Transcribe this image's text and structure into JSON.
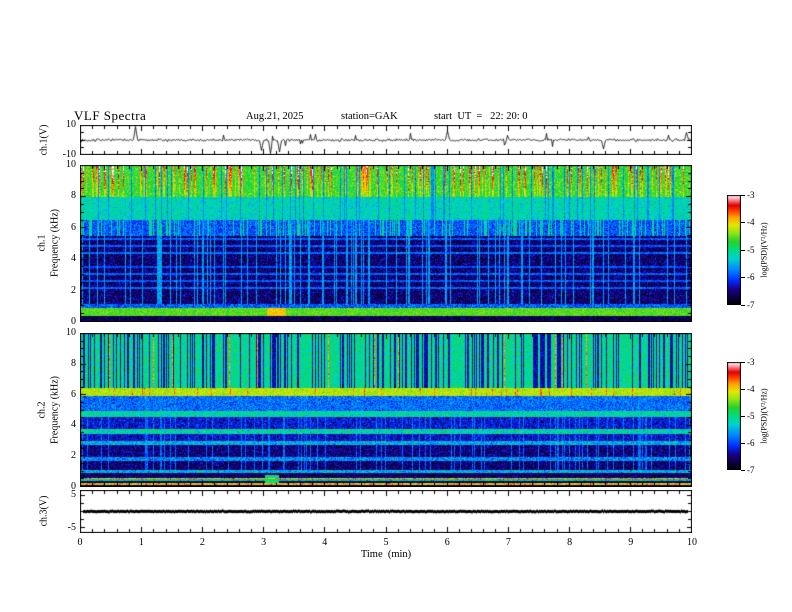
{
  "header": {
    "title": "VLF Spectra",
    "date": "Aug.21, 2025",
    "station": "station=GAK",
    "start_ut": "start  UT  =   22: 20: 0"
  },
  "x_axis": {
    "label": "Time  (min)",
    "ticks": [
      "0",
      "1",
      "2",
      "3",
      "4",
      "5",
      "6",
      "7",
      "8",
      "9",
      "10"
    ],
    "range_min": [
      0,
      10
    ]
  },
  "panels": {
    "ch1_wave": {
      "ylabel": "ch.1(V)",
      "ytick_top": "10",
      "ytick_bottom": "-10"
    },
    "ch1_spec": {
      "ylabel_ch": "ch.1",
      "ylabel_axis": "Frequency (kHz)"
    },
    "ch2_spec": {
      "ylabel_ch": "ch.2",
      "ylabel_axis": "Frequency (kHz)"
    },
    "ch3_wave": {
      "ylabel": "ch.3(V)",
      "ytick_top": "5",
      "ytick_bottom": "-5"
    }
  },
  "colorbars": [
    {
      "label": "log(PSD)(V²/Hz)",
      "ticks": [
        "-3",
        "-4",
        "-5",
        "-6",
        "-7"
      ],
      "value_top": -3,
      "value_bottom": -7
    },
    {
      "label": "log(PSD)(V²/Hz)",
      "ticks": [
        "-3",
        "-4",
        "-5",
        "-6",
        "-7"
      ],
      "value_top": -3,
      "value_bottom": -7
    }
  ],
  "colormap_stops": [
    [
      0.0,
      0,
      0,
      0
    ],
    [
      0.06,
      10,
      0,
      60
    ],
    [
      0.14,
      25,
      0,
      135
    ],
    [
      0.22,
      0,
      45,
      255
    ],
    [
      0.32,
      0,
      135,
      255
    ],
    [
      0.42,
      0,
      210,
      210
    ],
    [
      0.5,
      0,
      220,
      130
    ],
    [
      0.58,
      40,
      210,
      40
    ],
    [
      0.66,
      150,
      230,
      20
    ],
    [
      0.73,
      230,
      230,
      0
    ],
    [
      0.8,
      255,
      160,
      0
    ],
    [
      0.86,
      255,
      60,
      0
    ],
    [
      0.91,
      225,
      0,
      0
    ],
    [
      0.96,
      255,
      140,
      150
    ],
    [
      1.0,
      255,
      255,
      255
    ]
  ],
  "chart_data": [
    {
      "type": "line",
      "id": "ch1_waveform",
      "ylabel": "ch.1(V)",
      "ylim": [
        -10,
        10
      ],
      "yticks": [
        10,
        -10
      ],
      "x_range_min": [
        0,
        10
      ],
      "seed": 13,
      "appearance": {
        "color": "#000000",
        "noise_sigma_v": 0.85,
        "spike_prob": 0.02,
        "spike_max_v": 4.5
      },
      "features": [
        {
          "t_min": 0.9,
          "peak_v": 9
        },
        {
          "t_min": 2.95,
          "peak_v": -7
        },
        {
          "t_min": 3.1,
          "peak_v": -9
        },
        {
          "t_min": 3.25,
          "peak_v": -8
        },
        {
          "t_min": 6.0,
          "peak_v": 6
        },
        {
          "t_min": 8.55,
          "peak_v": -6
        },
        {
          "t_min": 9.9,
          "peak_v": 5
        }
      ]
    },
    {
      "type": "heatmap",
      "id": "ch1_spectrogram",
      "ylabel": [
        "ch.1",
        "Frequency (kHz)"
      ],
      "ylim": [
        0,
        10
      ],
      "yticks": [
        0,
        2,
        4,
        6,
        8,
        10
      ],
      "value_range": [
        -7,
        -3
      ],
      "seed": 77,
      "bands": [
        {
          "f0": 0.0,
          "f1": 0.12,
          "base": -5.0,
          "noise": 1.4
        },
        {
          "f0": 0.12,
          "f1": 0.42,
          "base": -6.65,
          "noise": 0.3
        },
        {
          "f0": 0.42,
          "f1": 0.95,
          "base": -4.55,
          "noise": 0.22
        },
        {
          "f0": 0.95,
          "f1": 1.15,
          "base": -5.9,
          "noise": 0.5
        },
        {
          "f0": 1.15,
          "f1": 5.5,
          "base": -6.55,
          "noise": 0.45
        },
        {
          "f0": 5.5,
          "f1": 6.5,
          "base": -5.95,
          "noise": 0.45
        },
        {
          "f0": 6.5,
          "f1": 8.0,
          "base": -5.25,
          "noise": 0.35
        },
        {
          "f0": 8.0,
          "f1": 10.01,
          "base": -4.65,
          "noise": 0.4
        }
      ],
      "h_lines": [
        {
          "f": 2.2,
          "value": -5.9
        },
        {
          "f": 2.65,
          "value": -5.95
        },
        {
          "f": 3.1,
          "value": -5.9
        },
        {
          "f": 3.55,
          "value": -6.0
        },
        {
          "f": 4.4,
          "value": -5.85
        },
        {
          "f": 4.85,
          "value": -5.95
        },
        {
          "f": 5.3,
          "value": -5.9
        }
      ],
      "v_streaks": [
        {
          "f0": 8.0,
          "f1": 10.01,
          "prob": 0.3,
          "mode": "add",
          "boost": 1.4
        },
        {
          "f0": 5.5,
          "f1": 8.0,
          "prob": 0.22,
          "mode": "max",
          "level": -5.1
        },
        {
          "f0": 1.15,
          "f1": 6.5,
          "prob": 0.15,
          "mode": "max",
          "level": -5.6
        },
        {
          "f0": 6.3,
          "f1": 10.01,
          "prob": 0.1,
          "mode": "min",
          "level": -5.7
        }
      ],
      "features": [
        {
          "t0": 3.05,
          "t1": 3.35,
          "f0": 0.42,
          "f1": 0.95,
          "mode": "add",
          "boost": 0.6
        }
      ]
    },
    {
      "type": "heatmap",
      "id": "ch2_spectrogram",
      "ylabel": [
        "ch.2",
        "Frequency (kHz)"
      ],
      "ylim": [
        0,
        10
      ],
      "yticks": [
        0,
        2,
        4,
        6,
        8,
        10
      ],
      "value_range": [
        -7,
        -3
      ],
      "seed": 99,
      "bands": [
        {
          "f0": 0.0,
          "f1": 0.18,
          "base": -6.8,
          "noise": 0.3
        },
        {
          "f0": 0.18,
          "f1": 0.3,
          "base": -3.95,
          "noise": 0.5
        },
        {
          "f0": 0.3,
          "f1": 0.42,
          "base": -6.7,
          "noise": 0.3
        },
        {
          "f0": 0.42,
          "f1": 0.52,
          "base": -5.3,
          "noise": 0.7
        },
        {
          "f0": 0.52,
          "f1": 0.64,
          "base": -3.9,
          "noise": 0.5
        },
        {
          "f0": 0.64,
          "f1": 0.95,
          "base": -6.6,
          "noise": 0.35
        },
        {
          "f0": 0.95,
          "f1": 1.15,
          "base": -5.5,
          "noise": 0.5
        },
        {
          "f0": 1.15,
          "f1": 1.75,
          "base": -6.55,
          "noise": 0.4
        },
        {
          "f0": 1.75,
          "f1": 1.95,
          "base": -5.7,
          "noise": 0.5
        },
        {
          "f0": 1.95,
          "f1": 2.75,
          "base": -6.5,
          "noise": 0.4
        },
        {
          "f0": 2.75,
          "f1": 3.0,
          "base": -5.5,
          "noise": 0.5
        },
        {
          "f0": 3.0,
          "f1": 3.45,
          "base": -6.3,
          "noise": 0.4
        },
        {
          "f0": 3.45,
          "f1": 3.8,
          "base": -5.15,
          "noise": 0.55
        },
        {
          "f0": 3.8,
          "f1": 4.6,
          "base": -6.25,
          "noise": 0.4
        },
        {
          "f0": 4.6,
          "f1": 5.0,
          "base": -5.15,
          "noise": 0.45
        },
        {
          "f0": 5.0,
          "f1": 5.95,
          "base": -5.85,
          "noise": 0.45
        },
        {
          "f0": 5.95,
          "f1": 6.45,
          "base": -4.25,
          "noise": 0.3
        },
        {
          "f0": 6.45,
          "f1": 10.01,
          "base": -5.05,
          "noise": 0.4
        }
      ],
      "h_lines": [],
      "v_streaks": [
        {
          "f0": 6.45,
          "f1": 10.01,
          "prob": 0.32,
          "mode": "min",
          "level": -6.35
        },
        {
          "f0": 6.45,
          "f1": 10.01,
          "prob": 0.03,
          "mode": "max",
          "level": -3.8
        },
        {
          "f0": 0.95,
          "f1": 6.0,
          "prob": 0.12,
          "mode": "max",
          "level": -5.85
        },
        {
          "f0": 5.95,
          "f1": 6.45,
          "prob": 0.06,
          "mode": "max",
          "level": -3.75
        }
      ],
      "features": [
        {
          "t0": 3.02,
          "t1": 3.25,
          "f0": 0.3,
          "f1": 0.8,
          "mode": "max",
          "level": -5.0
        }
      ]
    },
    {
      "type": "line",
      "id": "ch3_waveform",
      "ylabel": "ch.3(V)",
      "ylim": [
        -6.5,
        6.5
      ],
      "yticks": [
        5,
        -5
      ],
      "x_range_min": [
        0,
        10
      ],
      "seed": 5,
      "appearance": {
        "color": "#000000",
        "flat_value_v": 0,
        "thickness_v": 0.9
      }
    }
  ]
}
